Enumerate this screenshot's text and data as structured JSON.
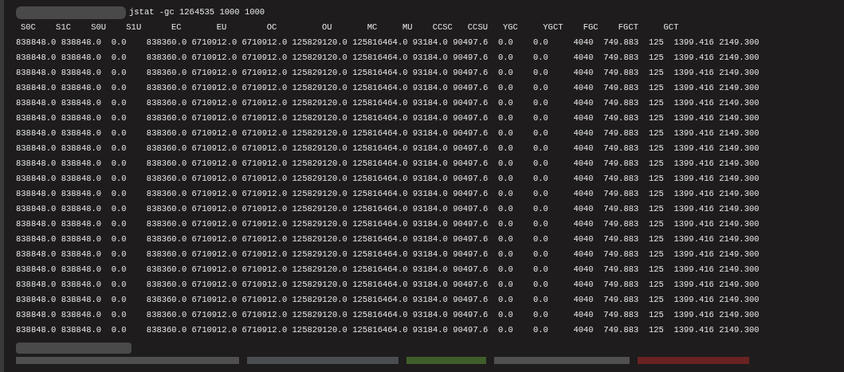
{
  "terminal": {
    "command": "jstat -gc 1264535 1000 1000",
    "header": "S0C    S1C    S0U    S1U      EC       EU        OC         OU       MC     MU    CCSC   CCSU   YGC     YGCT    FGC    FGCT     GCT",
    "rows": [
      "838848.0 838848.0  0.0    838360.0 6710912.0 6710912.0 125829120.0 125816464.0 93184.0 90497.6  0.0    0.0     4040  749.883  125  1399.416 2149.300",
      "838848.0 838848.0  0.0    838360.0 6710912.0 6710912.0 125829120.0 125816464.0 93184.0 90497.6  0.0    0.0     4040  749.883  125  1399.416 2149.300",
      "838848.0 838848.0  0.0    838360.0 6710912.0 6710912.0 125829120.0 125816464.0 93184.0 90497.6  0.0    0.0     4040  749.883  125  1399.416 2149.300",
      "838848.0 838848.0  0.0    838360.0 6710912.0 6710912.0 125829120.0 125816464.0 93184.0 90497.6  0.0    0.0     4040  749.883  125  1399.416 2149.300",
      "838848.0 838848.0  0.0    838360.0 6710912.0 6710912.0 125829120.0 125816464.0 93184.0 90497.6  0.0    0.0     4040  749.883  125  1399.416 2149.300",
      "838848.0 838848.0  0.0    838360.0 6710912.0 6710912.0 125829120.0 125816464.0 93184.0 90497.6  0.0    0.0     4040  749.883  125  1399.416 2149.300",
      "838848.0 838848.0  0.0    838360.0 6710912.0 6710912.0 125829120.0 125816464.0 93184.0 90497.6  0.0    0.0     4040  749.883  125  1399.416 2149.300",
      "838848.0 838848.0  0.0    838360.0 6710912.0 6710912.0 125829120.0 125816464.0 93184.0 90497.6  0.0    0.0     4040  749.883  125  1399.416 2149.300",
      "838848.0 838848.0  0.0    838360.0 6710912.0 6710912.0 125829120.0 125816464.0 93184.0 90497.6  0.0    0.0     4040  749.883  125  1399.416 2149.300",
      "838848.0 838848.0  0.0    838360.0 6710912.0 6710912.0 125829120.0 125816464.0 93184.0 90497.6  0.0    0.0     4040  749.883  125  1399.416 2149.300",
      "838848.0 838848.0  0.0    838360.0 6710912.0 6710912.0 125829120.0 125816464.0 93184.0 90497.6  0.0    0.0     4040  749.883  125  1399.416 2149.300",
      "838848.0 838848.0  0.0    838360.0 6710912.0 6710912.0 125829120.0 125816464.0 93184.0 90497.6  0.0    0.0     4040  749.883  125  1399.416 2149.300",
      "838848.0 838848.0  0.0    838360.0 6710912.0 6710912.0 125829120.0 125816464.0 93184.0 90497.6  0.0    0.0     4040  749.883  125  1399.416 2149.300",
      "838848.0 838848.0  0.0    838360.0 6710912.0 6710912.0 125829120.0 125816464.0 93184.0 90497.6  0.0    0.0     4040  749.883  125  1399.416 2149.300",
      "838848.0 838848.0  0.0    838360.0 6710912.0 6710912.0 125829120.0 125816464.0 93184.0 90497.6  0.0    0.0     4040  749.883  125  1399.416 2149.300",
      "838848.0 838848.0  0.0    838360.0 6710912.0 6710912.0 125829120.0 125816464.0 93184.0 90497.6  0.0    0.0     4040  749.883  125  1399.416 2149.300",
      "838848.0 838848.0  0.0    838360.0 6710912.0 6710912.0 125829120.0 125816464.0 93184.0 90497.6  0.0    0.0     4040  749.883  125  1399.416 2149.300",
      "838848.0 838848.0  0.0    838360.0 6710912.0 6710912.0 125829120.0 125816464.0 93184.0 90497.6  0.0    0.0     4040  749.883  125  1399.416 2149.300",
      "838848.0 838848.0  0.0    838360.0 6710912.0 6710912.0 125829120.0 125816464.0 93184.0 90497.6  0.0    0.0     4040  749.883  125  1399.416 2149.300",
      "838848.0 838848.0  0.0    838360.0 6710912.0 6710912.0 125829120.0 125816464.0 93184.0 90497.6  0.0    0.0     4040  749.883  125  1399.416 2149.300"
    ]
  }
}
